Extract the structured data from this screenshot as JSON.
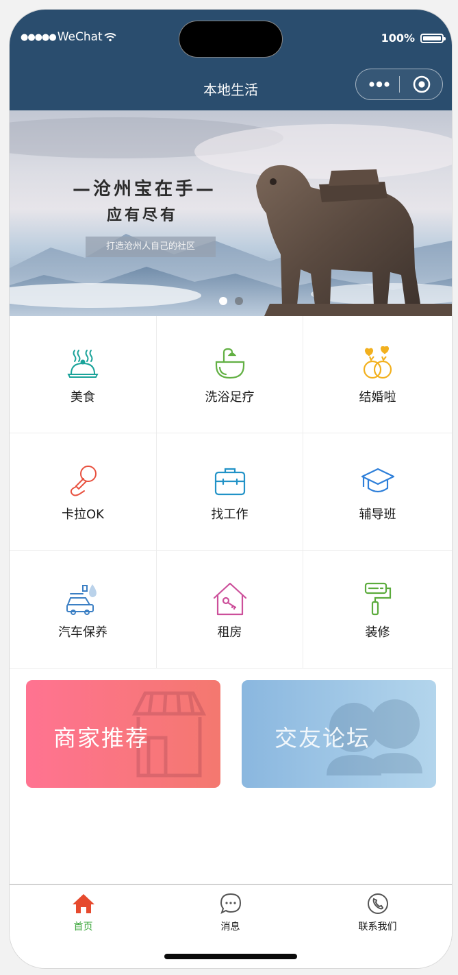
{
  "status_bar": {
    "signal_dots": "●●●●●",
    "carrier": "WeChat",
    "battery": "100%"
  },
  "header": {
    "title": "本地生活"
  },
  "banner": {
    "title_line1": "—沧州宝在手—",
    "title_line2": "应有尽有",
    "subtitle": "打造沧州人自己的社区",
    "indicator_count": 2,
    "active_index": 0
  },
  "categories": [
    {
      "label": "美食",
      "icon": "food-dome-icon",
      "color": "#1aa39a"
    },
    {
      "label": "洗浴足疗",
      "icon": "bathtub-icon",
      "color": "#62b043"
    },
    {
      "label": "结婚啦",
      "icon": "wedding-rings-icon",
      "color": "#f2b01e"
    },
    {
      "label": "卡拉OK",
      "icon": "microphone-icon",
      "color": "#e8513f"
    },
    {
      "label": "找工作",
      "icon": "briefcase-icon",
      "color": "#2192c7"
    },
    {
      "label": "辅导班",
      "icon": "graduation-cap-icon",
      "color": "#2e7fd9"
    },
    {
      "label": "汽车保养",
      "icon": "car-wash-icon",
      "color": "#3b7fc4"
    },
    {
      "label": "租房",
      "icon": "house-key-icon",
      "color": "#cc4f9a"
    },
    {
      "label": "装修",
      "icon": "paint-roller-icon",
      "color": "#5bab3c"
    }
  ],
  "cards": {
    "shop": {
      "label": "商家推荐"
    },
    "forum": {
      "label": "交友论坛"
    }
  },
  "tabbar": {
    "items": [
      {
        "label": "首页",
        "icon": "home-icon"
      },
      {
        "label": "消息",
        "icon": "message-icon"
      },
      {
        "label": "联系我们",
        "icon": "phone-icon"
      }
    ],
    "active_color": "#3aa63a",
    "active_icon_color": "#e64a2e"
  }
}
